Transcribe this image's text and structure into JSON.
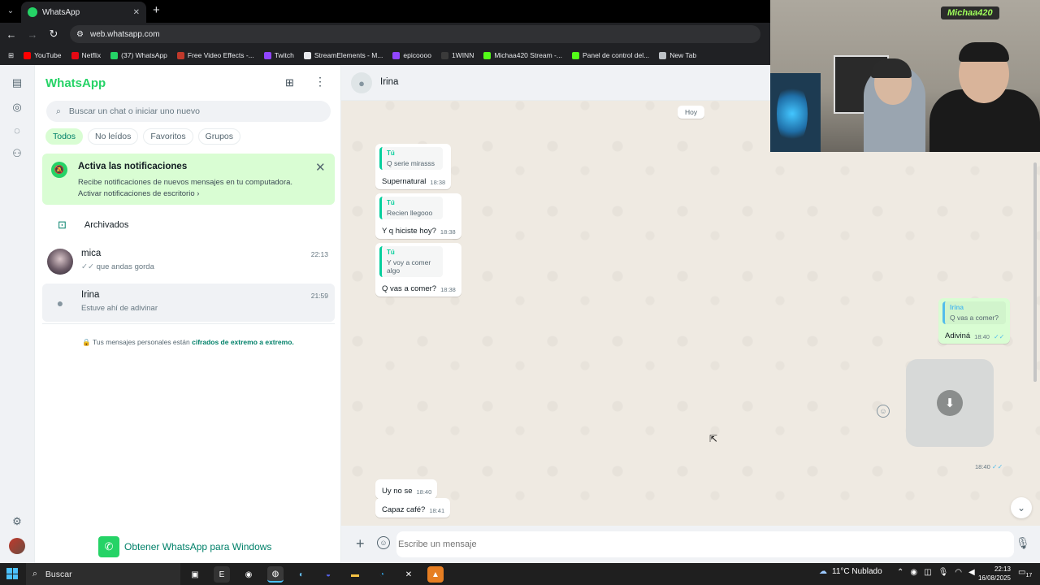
{
  "browser": {
    "tab_title": "WhatsApp",
    "url": "web.whatsapp.com",
    "bookmarks": [
      {
        "label": "YouTube",
        "color": "#ff0000"
      },
      {
        "label": "Netflix",
        "color": "#e50914"
      },
      {
        "label": "(37) WhatsApp",
        "color": "#25d366"
      },
      {
        "label": "Free Video Effects -...",
        "color": "#c0392b"
      },
      {
        "label": "Twitch",
        "color": "#9146ff"
      },
      {
        "label": "StreamElements - M...",
        "color": "#e8eaed"
      },
      {
        "label": "epicoooo",
        "color": "#9146ff"
      },
      {
        "label": "1WINN",
        "color": "#3a3a3a"
      },
      {
        "label": "Michaa420 Stream -...",
        "color": "#53fc18"
      },
      {
        "label": "Panel de control del...",
        "color": "#53fc18"
      },
      {
        "label": "New Tab",
        "color": "#bdc1c6"
      }
    ]
  },
  "sidebar": {
    "title": "WhatsApp",
    "search_placeholder": "Buscar un chat o iniciar uno nuevo",
    "filters": [
      "Todos",
      "No leídos",
      "Favoritos",
      "Grupos"
    ],
    "notification": {
      "title": "Activa las notificaciones",
      "body": "Recibe notificaciones de nuevos mensajes en tu computadora.",
      "link": "Activar notificaciones de escritorio"
    },
    "archived_label": "Archivados",
    "chats": [
      {
        "name": "mica",
        "time": "22:13",
        "preview": "que andas gorda",
        "ticks": "✓✓"
      },
      {
        "name": "Irina",
        "time": "21:59",
        "preview": "Estuve ahí de adivinar",
        "ticks": ""
      }
    ],
    "encrypted_text": "Tus mensajes personales están",
    "encrypted_link": "cifrados de extremo a extremo.",
    "get_windows": "Obtener WhatsApp para Windows"
  },
  "conversation": {
    "contact_name": "Irina",
    "day_label": "Hoy",
    "messages": [
      {
        "quote_author": "Tú",
        "quote_text": "Q serie mirasss",
        "text": "Supernatural",
        "time": "18:38"
      },
      {
        "quote_author": "Tú",
        "quote_text": "Recien llegooo",
        "text": "Y q hiciste hoy?",
        "time": "18:38"
      },
      {
        "quote_author": "Tú",
        "quote_text": "Y voy a comer algo",
        "text": "Q vas a comer?",
        "time": "18:38"
      },
      {
        "quote_author": "Irina",
        "quote_text": "Q vas a comer?",
        "text": "Adiviná",
        "time": "18:40",
        "ticks": "✓✓"
      },
      {
        "text": "Uy no se",
        "time": "18:40"
      },
      {
        "text": "Capaz café?",
        "time": "18:41"
      }
    ],
    "media_time": "18:40",
    "media_ticks": "✓✓",
    "composer_placeholder": "Escribe un mensaje"
  },
  "stream_overlay": {
    "tag": "Michaa420"
  },
  "taskbar": {
    "search_label": "Buscar",
    "weather": "11°C  Nublado",
    "time": "22:13",
    "date": "16/08/2025",
    "notif_count": "17"
  }
}
